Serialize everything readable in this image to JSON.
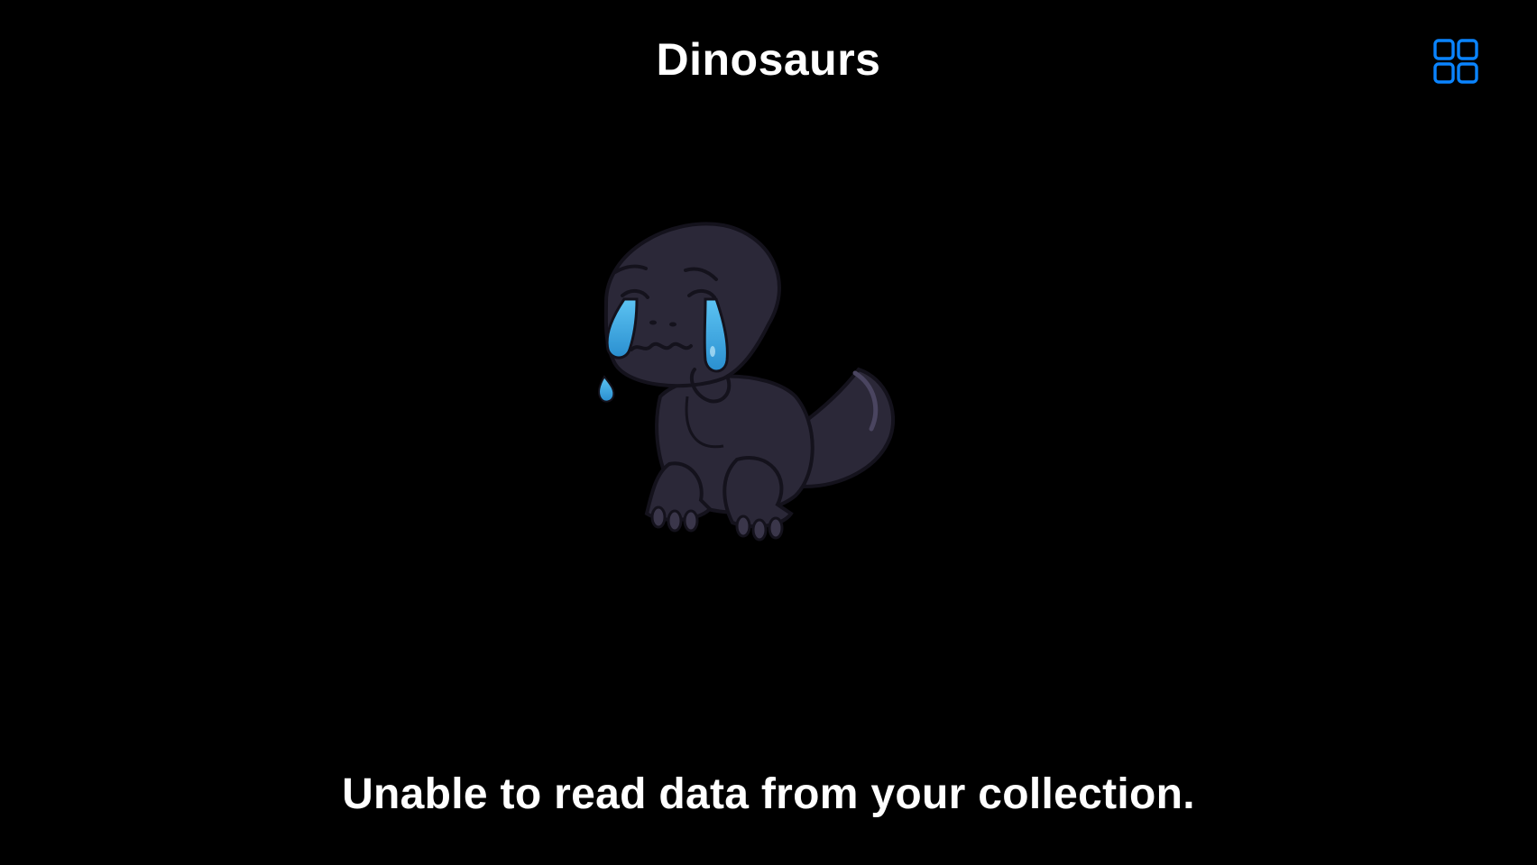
{
  "nav": {
    "title": "Dinosaurs",
    "grid_icon": "grid-layout-icon"
  },
  "empty_state": {
    "illustration": "crying-dinosaur",
    "message": "Unable to read data from your collection."
  },
  "colors": {
    "background": "#000000",
    "accent": "#0A84FF",
    "text": "#FFFFFF",
    "dino_body": "#2B2838",
    "tears": "#3FA9E0"
  }
}
